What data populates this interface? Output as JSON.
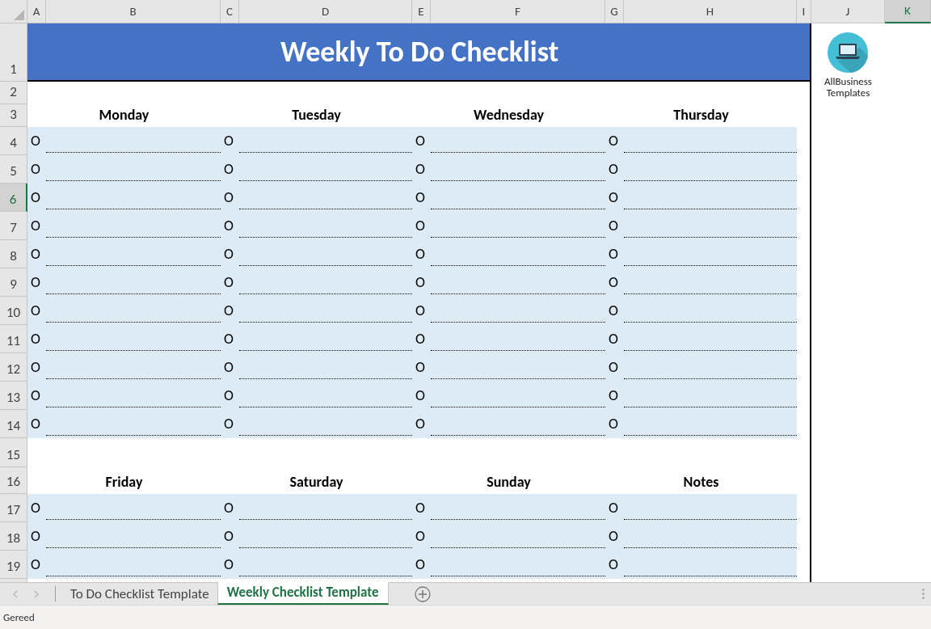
{
  "columns": [
    {
      "label": "A",
      "selected": false
    },
    {
      "label": "B",
      "selected": false
    },
    {
      "label": "C",
      "selected": false
    },
    {
      "label": "D",
      "selected": false
    },
    {
      "label": "E",
      "selected": false
    },
    {
      "label": "F",
      "selected": false
    },
    {
      "label": "G",
      "selected": false
    },
    {
      "label": "H",
      "selected": false
    },
    {
      "label": "I",
      "selected": false
    },
    {
      "label": "J",
      "selected": false
    },
    {
      "label": "K",
      "selected": true
    }
  ],
  "rows": [
    {
      "label": "1",
      "selected": false
    },
    {
      "label": "2",
      "selected": false
    },
    {
      "label": "3",
      "selected": false
    },
    {
      "label": "4",
      "selected": false
    },
    {
      "label": "5",
      "selected": false
    },
    {
      "label": "6",
      "selected": true
    },
    {
      "label": "7",
      "selected": false
    },
    {
      "label": "8",
      "selected": false
    },
    {
      "label": "9",
      "selected": false
    },
    {
      "label": "10",
      "selected": false
    },
    {
      "label": "11",
      "selected": false
    },
    {
      "label": "12",
      "selected": false
    },
    {
      "label": "13",
      "selected": false
    },
    {
      "label": "14",
      "selected": false
    },
    {
      "label": "15",
      "selected": false
    },
    {
      "label": "16",
      "selected": false
    },
    {
      "label": "17",
      "selected": false
    },
    {
      "label": "18",
      "selected": false
    },
    {
      "label": "19",
      "selected": false
    }
  ],
  "title": "Weekly To Do Checklist",
  "logo": {
    "line_1": "AllBusiness",
    "line_2": "Templates"
  },
  "sections": [
    {
      "days": [
        {
          "heading": "Monday",
          "items": [
            "O",
            "O",
            "O",
            "O",
            "O",
            "O",
            "O",
            "O",
            "O",
            "O",
            "O"
          ]
        },
        {
          "heading": "Tuesday",
          "items": [
            "O",
            "O",
            "O",
            "O",
            "O",
            "O",
            "O",
            "O",
            "O",
            "O",
            "O"
          ]
        },
        {
          "heading": "Wednesday",
          "items": [
            "O",
            "O",
            "O",
            "O",
            "O",
            "O",
            "O",
            "O",
            "O",
            "O",
            "O"
          ]
        },
        {
          "heading": "Thursday",
          "items": [
            "O",
            "O",
            "O",
            "O",
            "O",
            "O",
            "O",
            "O",
            "O",
            "O",
            "O"
          ]
        }
      ]
    },
    {
      "days": [
        {
          "heading": "Friday",
          "items": [
            "O",
            "O",
            "O"
          ]
        },
        {
          "heading": "Saturday",
          "items": [
            "O",
            "O",
            "O"
          ]
        },
        {
          "heading": "Sunday",
          "items": [
            "O",
            "O",
            "O"
          ]
        },
        {
          "heading": "Notes",
          "items": [
            "O",
            "O",
            "O"
          ]
        }
      ]
    }
  ],
  "sheet_tabs": [
    {
      "label": "To Do Checklist Template",
      "selected": false
    },
    {
      "label": "Weekly Checklist Template",
      "selected": true
    }
  ],
  "status": "Gereed"
}
